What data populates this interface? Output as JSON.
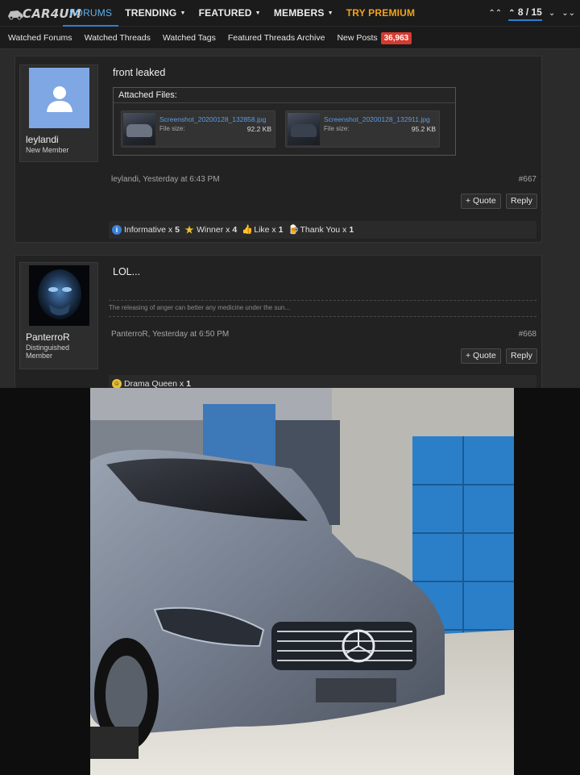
{
  "header": {
    "logo_text": "CAR4UM",
    "nav": [
      {
        "label": "FORUMS",
        "active": true
      },
      {
        "label": "TRENDING",
        "dropdown": true
      },
      {
        "label": "FEATURED",
        "dropdown": true
      },
      {
        "label": "MEMBERS",
        "dropdown": true
      },
      {
        "label": "TRY PREMIUM"
      }
    ],
    "page_counter": "8 / 15"
  },
  "subnav": {
    "items": [
      "Watched Forums",
      "Watched Threads",
      "Watched Tags",
      "Featured Threads Archive",
      "New Posts"
    ],
    "new_posts_count": "36,963"
  },
  "posts": [
    {
      "username": "leylandi",
      "user_title": "New Member",
      "message": "front leaked",
      "attachments_title": "Attached Files:",
      "attachments": [
        {
          "name": "Screenshot_20200128_132858.jpg",
          "size_label": "File size:",
          "size": "92.2 KB"
        },
        {
          "name": "Screenshot_20200128_132911.jpg",
          "size_label": "File size:",
          "size": "95.2 KB"
        }
      ],
      "meta": "leylandi, Yesterday at 6:43 PM",
      "post_number": "#667",
      "quote_label": "+ Quote",
      "reply_label": "Reply",
      "reactions": [
        {
          "icon": "info-icon",
          "label": "Informative x",
          "count": "5"
        },
        {
          "icon": "winner-icon",
          "label": "Winner x",
          "count": "4"
        },
        {
          "icon": "like-icon",
          "label": "Like x",
          "count": "1"
        },
        {
          "icon": "thank-you-icon",
          "label": "Thank You x",
          "count": "1"
        }
      ]
    },
    {
      "username": "PanterroR",
      "user_title": "Distinguished Member",
      "message": "LOL...",
      "signature": "The releasing of anger can better any medicine under the sun...",
      "meta": "PanterroR, Yesterday at 6:50 PM",
      "post_number": "#668",
      "quote_label": "+ Quote",
      "reply_label": "Reply",
      "reactions": [
        {
          "icon": "drama-queen-icon",
          "label": "Drama Queen x",
          "count": "1"
        }
      ]
    }
  ],
  "colors": {
    "accent_blue": "#2f7fd1",
    "premium_orange": "#f2a31b",
    "badge_red": "#d63a2f",
    "link_blue": "#5b9be0"
  }
}
